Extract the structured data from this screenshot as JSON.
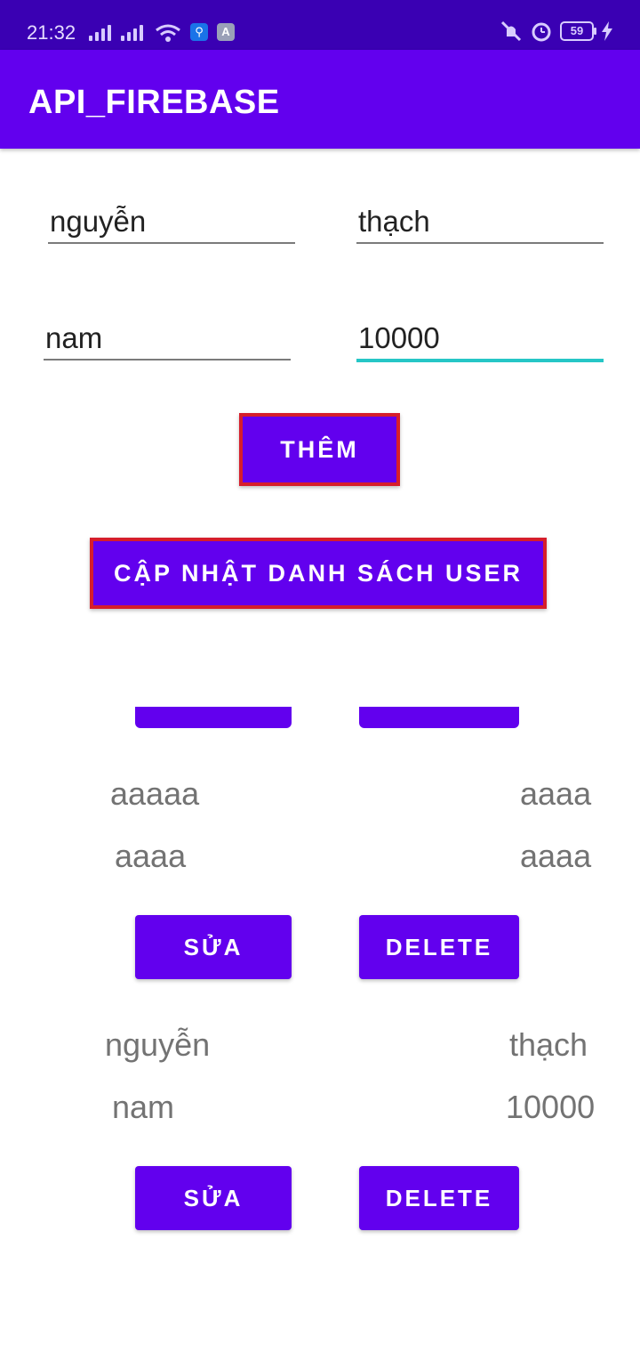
{
  "status": {
    "time": "21:32",
    "battery": "59",
    "icons": [
      "signal-icon",
      "signal-icon",
      "wifi-icon",
      "usb-icon",
      "app-icon",
      "mute-icon",
      "alarm-icon",
      "battery-icon",
      "charging-icon"
    ]
  },
  "appbar": {
    "title": "API_FIREBASE"
  },
  "form": {
    "first_name": "nguyễn",
    "last_name": "thạch",
    "gender": "nam",
    "amount": "10000"
  },
  "buttons": {
    "add": "THÊM",
    "refresh": "CẬP NHẬT DANH SÁCH USER"
  },
  "users": [
    {
      "first": "aaaaa",
      "last": "aaaa",
      "gender": "aaaa",
      "amount": "aaaa",
      "edit_label": "SỬA",
      "delete_label": "DELETE"
    },
    {
      "first": "nguyễn",
      "last": "thạch",
      "gender": "nam",
      "amount": "10000",
      "edit_label": "SỬA",
      "delete_label": "DELETE"
    }
  ],
  "colors": {
    "primary": "#6200ee",
    "status_bar": "#3a00b3",
    "accent": "#26c6c6",
    "highlight": "#d61e2b"
  }
}
